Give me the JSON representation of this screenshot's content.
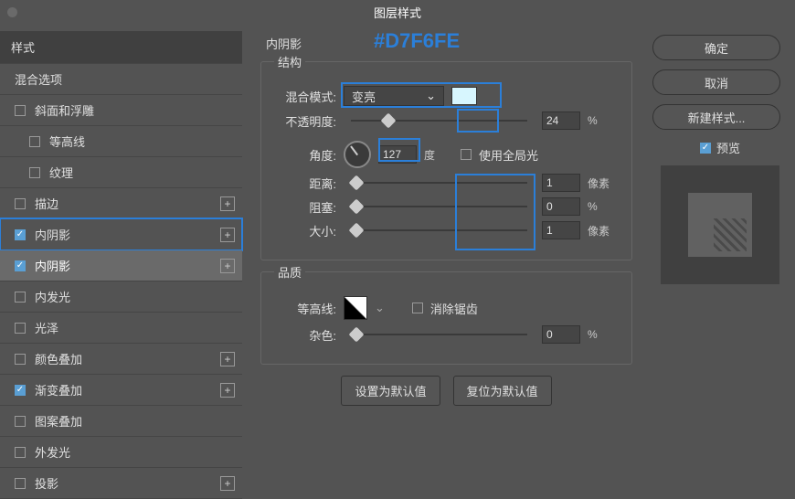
{
  "window": {
    "title": "图层样式"
  },
  "annotation": {
    "hex": "#D7F6FE"
  },
  "sidebar": {
    "header": "样式",
    "blendOptions": "混合选项",
    "items": [
      {
        "label": "斜面和浮雕",
        "checked": false,
        "sub": false,
        "plus": false
      },
      {
        "label": "等高线",
        "checked": false,
        "sub": true,
        "plus": false
      },
      {
        "label": "纹理",
        "checked": false,
        "sub": true,
        "plus": false
      },
      {
        "label": "描边",
        "checked": false,
        "sub": false,
        "plus": true
      },
      {
        "label": "内阴影",
        "checked": true,
        "sub": false,
        "plus": true,
        "highlight": true
      },
      {
        "label": "内阴影",
        "checked": true,
        "sub": false,
        "plus": true,
        "selected": true
      },
      {
        "label": "内发光",
        "checked": false,
        "sub": false,
        "plus": false
      },
      {
        "label": "光泽",
        "checked": false,
        "sub": false,
        "plus": false
      },
      {
        "label": "颜色叠加",
        "checked": false,
        "sub": false,
        "plus": true
      },
      {
        "label": "渐变叠加",
        "checked": true,
        "sub": false,
        "plus": true
      },
      {
        "label": "图案叠加",
        "checked": false,
        "sub": false,
        "plus": false
      },
      {
        "label": "外发光",
        "checked": false,
        "sub": false,
        "plus": false
      },
      {
        "label": "投影",
        "checked": false,
        "sub": false,
        "plus": true
      }
    ]
  },
  "panel": {
    "title": "内阴影",
    "group1": {
      "title": "结构",
      "blendModeLabel": "混合模式:",
      "blendModeValue": "变亮",
      "colorHex": "#D7F6FE",
      "opacityLabel": "不透明度:",
      "opacityValue": "24",
      "opacityUnit": "%",
      "angleLabel": "角度:",
      "angleValue": "127",
      "angleUnit": "度",
      "globalLabel": "使用全局光",
      "distanceLabel": "距离:",
      "distanceValue": "1",
      "distanceUnit": "像素",
      "chokeLabel": "阻塞:",
      "chokeValue": "0",
      "chokeUnit": "%",
      "sizeLabel": "大小:",
      "sizeValue": "1",
      "sizeUnit": "像素"
    },
    "group2": {
      "title": "品质",
      "contourLabel": "等高线:",
      "antialiasLabel": "消除锯齿",
      "noiseLabel": "杂色:",
      "noiseValue": "0",
      "noiseUnit": "%"
    },
    "defaultBtn": "设置为默认值",
    "resetBtn": "复位为默认值"
  },
  "right": {
    "ok": "确定",
    "cancel": "取消",
    "newStyle": "新建样式...",
    "preview": "预览"
  }
}
